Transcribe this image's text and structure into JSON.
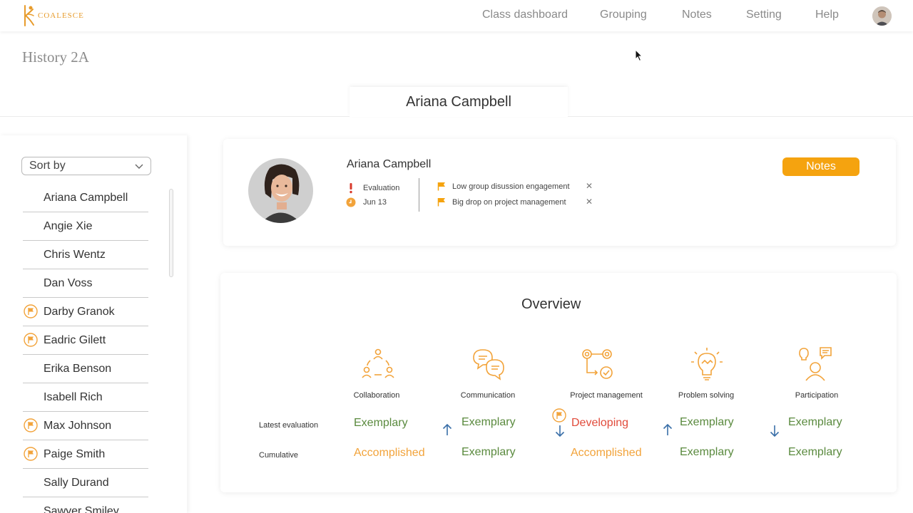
{
  "app": {
    "name": "COALESCE"
  },
  "nav": {
    "items": [
      "Class dashboard",
      "Grouping",
      "Notes",
      "Setting",
      "Help"
    ]
  },
  "page": {
    "title": "History 2A"
  },
  "student_tab": {
    "label": "Ariana Campbell"
  },
  "sidebar": {
    "sort_label": "Sort by",
    "students": [
      {
        "name": "Ariana Campbell",
        "flagged": false
      },
      {
        "name": "Angie Xie",
        "flagged": false
      },
      {
        "name": "Chris Wentz",
        "flagged": false
      },
      {
        "name": "Dan Voss",
        "flagged": false
      },
      {
        "name": "Darby Granok",
        "flagged": true
      },
      {
        "name": "Eadric Gilett",
        "flagged": true
      },
      {
        "name": "Erika Benson",
        "flagged": false
      },
      {
        "name": "Isabell Rich",
        "flagged": false
      },
      {
        "name": "Max Johnson",
        "flagged": true
      },
      {
        "name": "Paige Smith",
        "flagged": true
      },
      {
        "name": "Sally Durand",
        "flagged": false
      },
      {
        "name": "Sawyer Smiley",
        "flagged": false
      }
    ]
  },
  "profile": {
    "name": "Ariana Campbell",
    "status": "Evaluation",
    "date": "Jun 13",
    "alerts": [
      "Low group disussion engagement",
      "Big drop on project management"
    ],
    "notes_button": "Notes"
  },
  "overview": {
    "title": "Overview",
    "row_labels": {
      "latest": "Latest evaluation",
      "cumulative": "Cumulative"
    },
    "skills": [
      {
        "name": "Collaboration",
        "icon": "collaboration-icon",
        "latest": "Exemplary",
        "latest_color": "#5a8a3e",
        "trend": "none",
        "cumulative": "Accomplished",
        "cumulative_color": "#f2a33a"
      },
      {
        "name": "Communication",
        "icon": "communication-icon",
        "latest": "Exemplary",
        "latest_color": "#5a8a3e",
        "trend": "up",
        "cumulative": "Exemplary",
        "cumulative_color": "#5a8a3e"
      },
      {
        "name": "Project management",
        "icon": "project-management-icon",
        "latest": "Developing",
        "latest_color": "#e14b3b",
        "trend": "down",
        "flagged": true,
        "cumulative": "Accomplished",
        "cumulative_color": "#f2a33a"
      },
      {
        "name": "Problem solving",
        "icon": "problem-solving-icon",
        "latest": "Exemplary",
        "latest_color": "#5a8a3e",
        "trend": "up",
        "cumulative": "Exemplary",
        "cumulative_color": "#5a8a3e"
      },
      {
        "name": "Participation",
        "icon": "participation-icon",
        "latest": "Exemplary",
        "latest_color": "#5a8a3e",
        "trend": "down",
        "cumulative": "Exemplary",
        "cumulative_color": "#5a8a3e"
      }
    ]
  },
  "colors": {
    "accent": "#f5a30f",
    "arrow": "#3a6fa8"
  }
}
